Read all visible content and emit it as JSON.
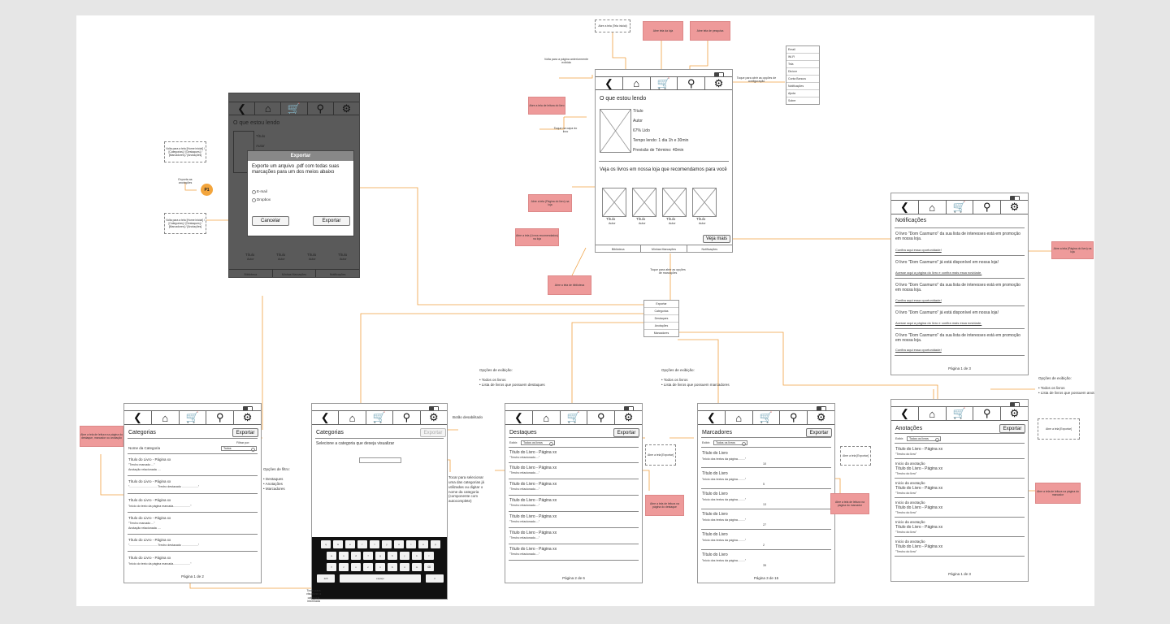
{
  "nav_icons": [
    "back-icon",
    "home-icon",
    "cart-icon",
    "search-icon",
    "gear-icon"
  ],
  "home": {
    "title": "O que estou lendo",
    "book_title": "Título",
    "book_author": "Autor",
    "progress": "67% Lido",
    "time_read": "Tempo lendo: 1 dia 1h e 30min",
    "forecast": "Previsão de Término: 40min",
    "reco_title": "Veja os livros em nossa loja que recomendamos para você",
    "reco_items": [
      {
        "t": "Título",
        "a": "Autor"
      },
      {
        "t": "Título",
        "a": "Autor"
      },
      {
        "t": "Título",
        "a": "Autor"
      },
      {
        "t": "Título",
        "a": "Autor"
      }
    ],
    "more_button": "Veja mais",
    "tabs": [
      "Biblioteca",
      "Minhas Marcações",
      "Notificações"
    ]
  },
  "settings_menu": [
    "Email",
    "Wi-Fi",
    "Tela",
    "Dicionr",
    "Conta Bancos",
    "Notificações",
    "Ajuda",
    "Sobre"
  ],
  "export_menu": [
    "Exportar",
    "Categorias",
    "Destaques",
    "Anotações",
    "Marcadores"
  ],
  "export_dialog": {
    "header": "Exportar",
    "message": "Exporte um arquivo .pdf com todas suas marcações para um dos meios abaixo",
    "options": [
      "E-mail",
      "Dropbox"
    ],
    "cancel": "Cancelar",
    "confirm": "Exportar",
    "badge": "P1",
    "bg_title": "O que estou lendo",
    "bg_lines": [
      "Título",
      "Autor"
    ],
    "bg_items": [
      {
        "t": "Título",
        "a": "Autor"
      },
      {
        "t": "Título",
        "a": "Autor"
      },
      {
        "t": "Título",
        "a": "Autor"
      },
      {
        "t": "Título",
        "a": "Autor"
      }
    ],
    "bg_tabs": [
      "Biblioteca",
      "Minhas Marcações",
      "Notificações"
    ]
  },
  "notifications": {
    "title": "Notificações",
    "items": [
      {
        "text": "O livro \"Dom Casmurro\" da sua lista de interesses está em promoção em nossa loja.",
        "link": "Confira aqui essa oportunidade!"
      },
      {
        "text": "O livro \"Dom Casmurro\" já está disponível em nossa loja!",
        "link": "Acesse aqui a página do livro e confira mais essa novidade."
      },
      {
        "text": "O livro \"Dom Casmurro\" da sua lista de interesses está em promoção em nossa loja.",
        "link": "Confira aqui essa oportunidade!"
      },
      {
        "text": "O livro \"Dom Casmurro\" já está disponível em nossa loja!",
        "link": "Acesse aqui a página do livro e confira mais essa novidade."
      },
      {
        "text": "O livro \"Dom Casmurro\" da sua lista de interesses está em promoção em nossa loja.",
        "link": "Confira aqui essa oportunidade!"
      }
    ],
    "page": "Página 1 de 3"
  },
  "categorias": {
    "title": "Categorias",
    "export": "Exportar",
    "filter_label": "Filtrar por:",
    "filter_value": "Todos",
    "col_name": "Nome da Categoria",
    "items": [
      [
        "Título do Livro - Página xx",
        "\"Trecho marcado ...\"",
        "Anotação relacionada ...."
      ],
      [
        "Título do Livro - Página xx",
        "\"...................................Trecho destacado ....................\""
      ],
      [
        "Título do Livro - Página xx",
        "\"Inicio do texto da página marcada.....................\""
      ],
      [
        "Título do Livro - Página xx",
        "\"Trecho marcado ...\"",
        "Anotação relacionada ...."
      ],
      [
        "Título do Livro - Página xx",
        "\"...................................Trecho destacado ....................\""
      ],
      [
        "Título do Livro - Página xx",
        "\"Inicio do texto da página marcada.....................\""
      ]
    ],
    "page": "Página 1 de 2"
  },
  "categorias_select": {
    "title": "Categorias",
    "export": "Exportar",
    "prompt": "Selecione a categoria  que deseja visualizar",
    "keyboard_rows": [
      [
        "q",
        "w",
        "e",
        "r",
        "t",
        "y",
        "u",
        "i",
        "o",
        "p"
      ],
      [
        "a",
        "s",
        "d",
        "f",
        "g",
        "h",
        "j",
        "k",
        "l"
      ],
      [
        "⇧",
        "z",
        "x",
        "c",
        "v",
        "b",
        "n",
        "m",
        "⌫"
      ]
    ],
    "key_num": "123",
    "key_space": "espaço",
    "key_go": "ir"
  },
  "destaques": {
    "title": "Destaques",
    "export": "Exportar",
    "filter_label": "Exibir:",
    "filter_value": "Todos os livros",
    "items": [
      "Título do Livro - Página xx",
      "Título do Livro - Página xx",
      "Título do Livro - Página xx",
      "Título do Livro - Página xx",
      "Título do Livro - Página xx",
      "Título do Livro - Página xx",
      "Título do Livro - Página xx"
    ],
    "sub": "\"Trecho relacionado....\"",
    "page": "Página 2 de 6"
  },
  "marcadores": {
    "title": "Marcadores",
    "export": "Exportar",
    "filter_label": "Exibir:",
    "filter_value": "Todos os livros",
    "items": [
      {
        "t": "Título do Livro",
        "s": "\"Inicio dos textos da página.........\"",
        "n": "10"
      },
      {
        "t": "Título do Livro",
        "s": "\"Inicio dos textos da página.........\"",
        "n": "5"
      },
      {
        "t": "Título do Livro",
        "s": "\"Inicio dos textos da página.........\"",
        "n": "13"
      },
      {
        "t": "Título do Livro",
        "s": "\"Inicio dos textos da página.........\"",
        "n": "27"
      },
      {
        "t": "Título do Livro",
        "s": "\"Inicio dos textos da página.........\"",
        "n": "2"
      },
      {
        "t": "Título do Livro",
        "s": "\"Inicio dos textos da página.........\"",
        "n": "35"
      }
    ],
    "page": "Página 3 de 15"
  },
  "anotacoes": {
    "title": "Anotações",
    "export": "Exportar",
    "filter_label": "Exibir:",
    "filter_value": "Todos os livros",
    "items": [
      {
        "h": "",
        "t": "Título do Livro - Página xx",
        "s": "\"Trecho do livro\""
      },
      {
        "h": "Inicio da anotação",
        "t": "Título do Livro - Página xx",
        "s": "\"Trecho do livro\""
      },
      {
        "h": "Inicio da anotação",
        "t": "Título do Livro - Página xx",
        "s": "\"Trecho do livro\""
      },
      {
        "h": "Inicio da anotação",
        "t": "Título do Livro - Página xx",
        "s": "\"Trecho do livro\""
      },
      {
        "h": "Inicio da anotação",
        "t": "Título do Livro - Página xx",
        "s": "\"Trecho do livro\""
      },
      {
        "h": "Inicio da anotação",
        "t": "Título do Livro - Página xx",
        "s": "\"Trecho do livro\""
      }
    ],
    "page": "Página 1 de 3"
  },
  "annotations": {
    "top_dashed": "Abre a tela (Tela inicial)",
    "top_red1": "Abre tela da loja",
    "top_red2": "Abre tela de pesquisa",
    "back_note": "Volta para a página anteriormente exibida",
    "settings_note": "Toque para abrir as opções de configuração",
    "read_red": "Abre a tela de leitura do livro",
    "cover_note": "Toque na capa do livro",
    "store_red": "Abre a tela (Página do livro) na loja",
    "reco_red": "Abre a tela (Livros recomendados) na loja",
    "library_red": "Abre a tela de biblioteca",
    "marks_note": "Toque para abrir as opções de marcações",
    "notif_red": "Abre a tela (Página do livro) na loja",
    "export_back_note": "Volta para a tela [Home inicial] / [Categorias] / [Destaques] / [Marcadores] / [Anotações]",
    "export_annot_note": "Exporta as anotações",
    "export_cancel_note": "Volta para a tela [Home inicial] / [Categorias] / [Destaques] / [Marcadores] / [Anotações]",
    "cat_red": "Abre a tela de leitura na página do destaque, marcador ou anotação",
    "cat_filter_title": "Opções de filtro:",
    "cat_filter_items": "• Destaques\n• Anotações\n• Marcadores",
    "disabled_note": "Botão desabilitado",
    "autocomplete_note": "Tocar para selecionar uma das categorias já utilizadas ou digitar o nome da categoria (componente com autocomplete)",
    "keyboard_note": "Tocar para visualizar a categoria informada",
    "dest_options": "Opções de exibição:\n\n• Todos os livros\n• Lista de livros que possuem destaques",
    "dest_dashed": "Abre a tela [Exportar]",
    "dest_red": "Abre a tela de leitura na página do destaque",
    "marc_options": "Opções de exibição:\n\n• Todos os livros\n• Lista de livros que possuem marcadores",
    "marc_dashed": "Abre a tela [Exportar]",
    "marc_red": "Abre a tela de leitura na página do marcador",
    "anot_options": "Opções de exibição:\n\n• Todos os livros\n• Lista de livros que possuem anotações",
    "anot_dashed": "Abre a tela [Exportar]",
    "anot_red": "Abre a tela de leitura na página do marcador"
  }
}
